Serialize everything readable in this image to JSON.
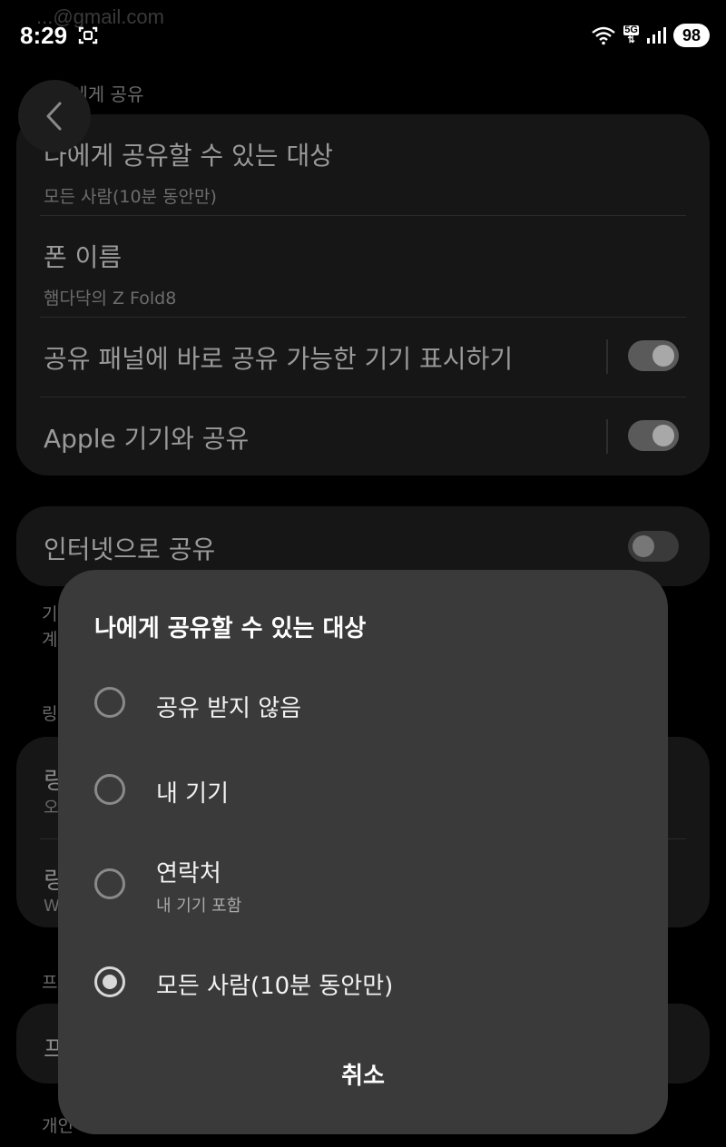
{
  "status_bar": {
    "time": "8:29",
    "battery": "98",
    "network_label": "5G",
    "faint_account": "...@gmail.com"
  },
  "background": {
    "section_top_label": "나에게 공유",
    "card1": {
      "row1_title": "나에게 공유할 수 있는 대상",
      "row1_sub": "모든 사람(10분 동안만)",
      "row2_title": "폰 이름",
      "row2_sub": "햄다닥의 Z Fold8",
      "row3_title": "공유 패널에 바로 공유 가능한 기기 표시하기",
      "row3_toggle": "on",
      "row4_title": "Apple 기기와 공유",
      "row4_toggle": "on"
    },
    "card2": {
      "row1_title": "인터넷으로 공유",
      "row1_toggle": "off"
    },
    "peek_left_lines": [
      "기",
      "계",
      "링",
      "링",
      "오",
      "링",
      "W",
      "프",
      "프",
      "개인"
    ]
  },
  "dialog": {
    "title": "나에게 공유할 수 있는 대상",
    "options": [
      {
        "label": "공유 받지 않음",
        "sub": "",
        "selected": false
      },
      {
        "label": "내 기기",
        "sub": "",
        "selected": false
      },
      {
        "label": "연락처",
        "sub": "내 기기 포함",
        "selected": false
      },
      {
        "label": "모든 사람(10분 동안만)",
        "sub": "",
        "selected": true
      }
    ],
    "cancel_label": "취소"
  },
  "colors": {
    "dialog_bg": "#3a3a3a",
    "card_bg": "#161616",
    "page_bg": "#000000"
  }
}
